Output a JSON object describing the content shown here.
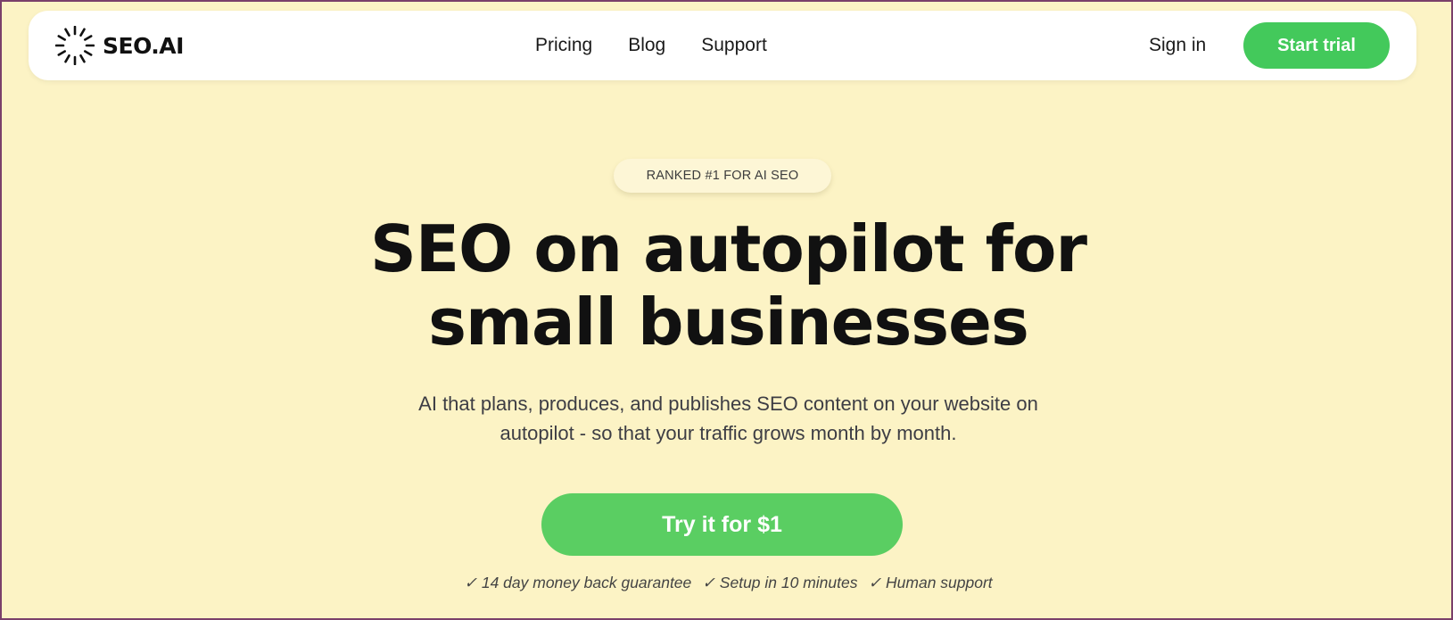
{
  "nav": {
    "logo_text": "SEO.AI",
    "links": [
      {
        "label": "Pricing"
      },
      {
        "label": "Blog"
      },
      {
        "label": "Support"
      }
    ],
    "sign_in_label": "Sign in",
    "start_trial_label": "Start trial"
  },
  "hero": {
    "badge": "RANKED #1 FOR AI SEO",
    "headline_line1": "SEO on autopilot for",
    "headline_line2": "small businesses",
    "subtitle_line1": "AI that plans, produces, and publishes SEO content on your website on",
    "subtitle_line2": "autopilot - so that your traffic grows month by month.",
    "cta_label": "Try it for $1",
    "features": [
      "✓ 14 day money back guarantee",
      "✓ Setup in 10 minutes",
      "✓ Human support"
    ]
  },
  "colors": {
    "background": "#fcf3c5",
    "accent_green": "#43c95b",
    "cta_green": "#5ace62",
    "nav_background": "#ffffff",
    "text_dark": "#111111"
  },
  "icons": {
    "logo": "sunburst-logo-icon"
  }
}
